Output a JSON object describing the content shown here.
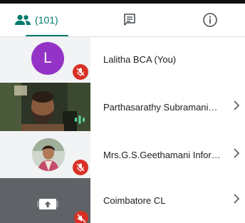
{
  "tabs": {
    "people": {
      "icon": "people-icon",
      "count_label": "(101)"
    },
    "chat": {
      "icon": "chat-icon"
    },
    "info": {
      "icon": "info-icon"
    }
  },
  "participants": [
    {
      "avatar_letter": "L",
      "name": "Lalitha BCA (You)",
      "status_icon": "mic-off-icon",
      "avatar_color": "#9334c7"
    },
    {
      "name": "Parthasarathy Subramani…",
      "status_icon": "speaking-icon"
    },
    {
      "name": "Mrs.G.S.Geethamani Infor…",
      "status_icon": "mic-off-icon"
    },
    {
      "name": "Coimbatore CL",
      "status_icon": "speaker-off-icon",
      "thumb_icon": "present-screen-icon"
    }
  ],
  "colors": {
    "accent": "#00796b",
    "mute_red": "#d93025"
  }
}
